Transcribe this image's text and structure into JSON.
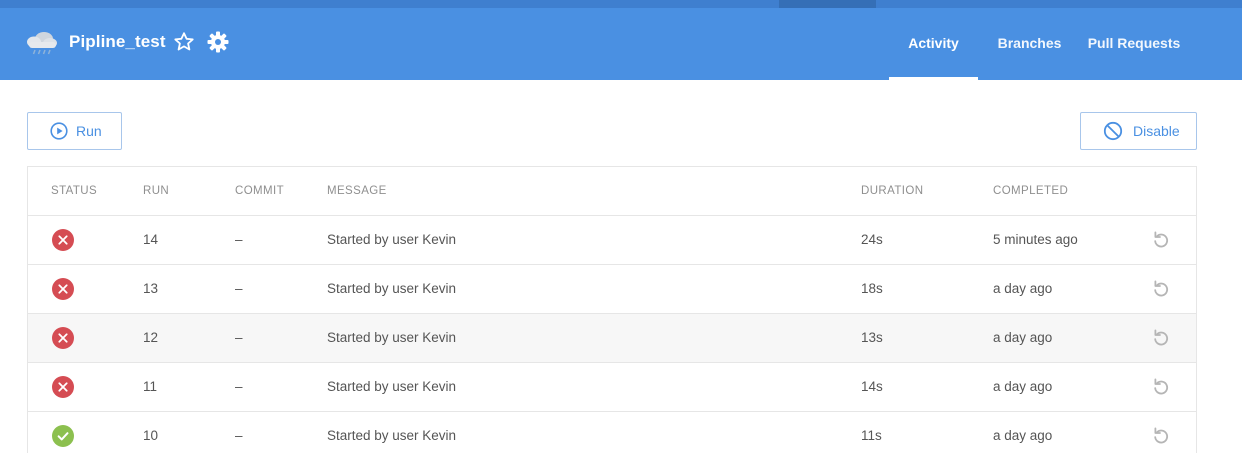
{
  "header": {
    "title": "Pipline_test",
    "weather_icon": "rain-cloud-icon",
    "star_icon": "star-outline-icon",
    "settings_icon": "gear-icon"
  },
  "nav": {
    "tabs": [
      {
        "label": "Activity",
        "active": true
      },
      {
        "label": "Branches",
        "active": false
      },
      {
        "label": "Pull Requests",
        "active": false
      }
    ]
  },
  "actions": {
    "run_label": "Run",
    "disable_label": "Disable"
  },
  "table": {
    "columns": [
      "STATUS",
      "RUN",
      "COMMIT",
      "MESSAGE",
      "DURATION",
      "COMPLETED"
    ],
    "rows": [
      {
        "status": "failed",
        "run": "14",
        "commit": "–",
        "message": "Started by user Kevin",
        "duration": "24s",
        "completed": "5 minutes ago"
      },
      {
        "status": "failed",
        "run": "13",
        "commit": "–",
        "message": "Started by user Kevin",
        "duration": "18s",
        "completed": "a day ago"
      },
      {
        "status": "failed",
        "run": "12",
        "commit": "–",
        "message": "Started by user Kevin",
        "duration": "13s",
        "completed": "a day ago"
      },
      {
        "status": "failed",
        "run": "11",
        "commit": "–",
        "message": "Started by user Kevin",
        "duration": "14s",
        "completed": "a day ago"
      },
      {
        "status": "success",
        "run": "10",
        "commit": "–",
        "message": "Started by user Kevin",
        "duration": "11s",
        "completed": "a day ago"
      }
    ]
  },
  "colors": {
    "header_bg": "#4a90e2",
    "accent": "#4a90e2",
    "failed": "#d54c53",
    "success": "#8cc04f"
  }
}
